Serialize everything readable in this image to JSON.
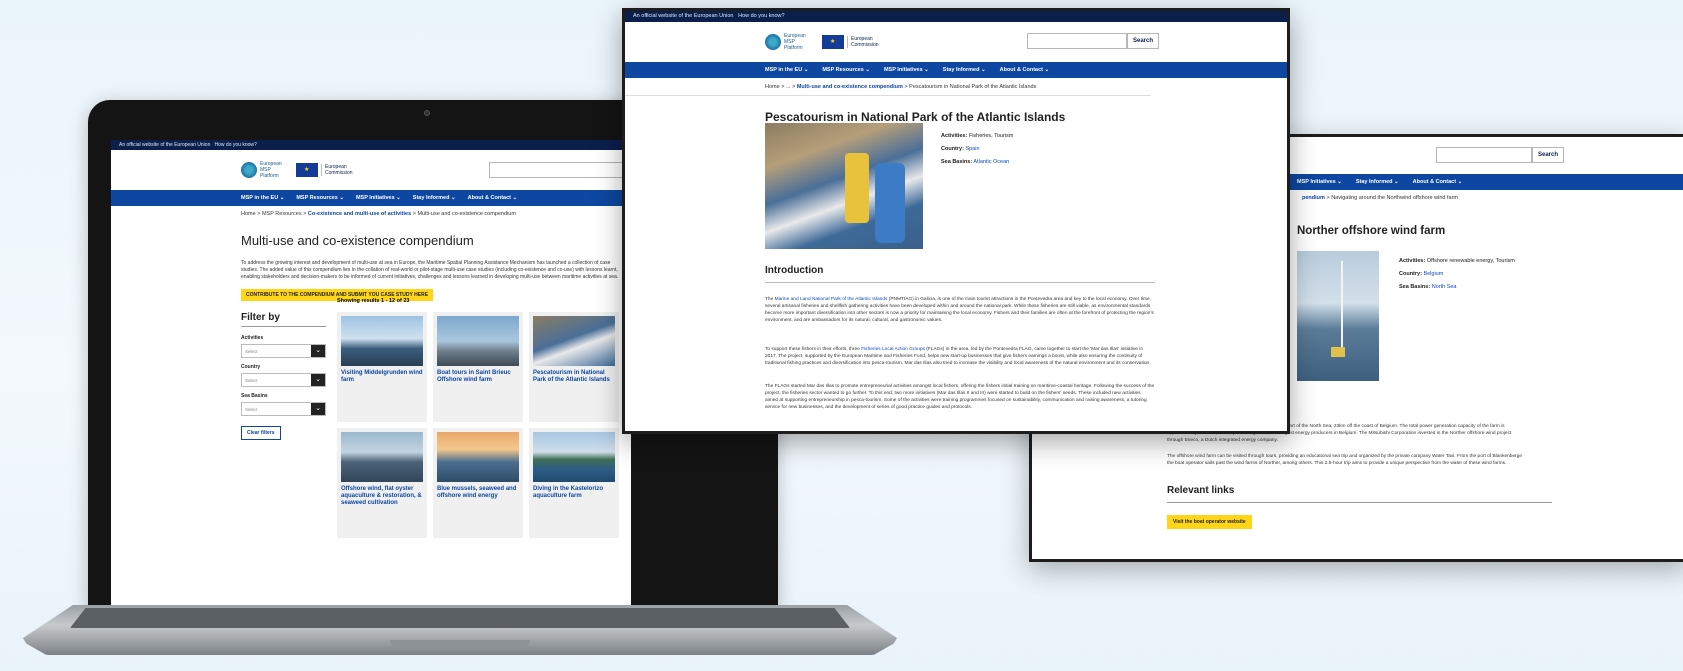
{
  "eu_strip": {
    "text": "An official website of the European Union",
    "link": "How do you know?"
  },
  "brand": {
    "logo_text": "European MSP Platform",
    "ec_text": "European Commission"
  },
  "search": {
    "button": "Search"
  },
  "nav": {
    "items": [
      "MSP in the EU ⌄",
      "MSP Resources ⌄",
      "MSP Initiatives ⌄",
      "Stay Informed ⌄",
      "About & Contact ⌄"
    ]
  },
  "laptop": {
    "breadcrumb": {
      "home": "Home",
      "sep": ">",
      "msp": "MSP Resources",
      "coex": "Co-existence and multi-use of activities",
      "current": "Multi-use and co-existence compendium"
    },
    "title": "Multi-use and co-existence compendium",
    "intro": "To address the growing interest and development of multi-use at sea in Europe, the Maritime Spatial Planning Assistance Mechanism has launched a collection of case studies. The added value of this compendium lies in the collation of real-world or pilot-stage multi-use case studies (including co-existence and co-use) with lessons learnt, enabling stakeholders and decision-makers to be informed of current initiatives, challenges and lessons learned in developing multi-use between maritime activities at sea.",
    "contribute_button": "CONTRIBUTE TO THE COMPENDIUM AND SUBMIT YOU CASE STUDY HERE",
    "results": "Showing results 1 - 12 of 23",
    "filter": {
      "title": "Filter by",
      "activities": "Activities",
      "country": "Country",
      "sea_basins": "Sea Basins",
      "select_placeholder": "Select",
      "clear": "Clear filters"
    },
    "cards": [
      "Visiting Middelgrunden wind farm",
      "Boat tours in Saint Brieuc Offshore wind farm",
      "Pescatourism in National Park of the Atlantic Islands",
      "Offshore wind, flat oyster aquaculture & restoration, & seaweed cultivation",
      "Blue mussels, seaweed and offshore wind energy",
      "Diving in the Kastelorizo aquaculture farm"
    ]
  },
  "center": {
    "breadcrumb": {
      "home": "Home",
      "sep": ">",
      "ellipsis": "...",
      "compendium": "Multi-use and co-existence compendium",
      "current": "Pescatourism in National Park of the Atlantic Islands"
    },
    "title": "Pescatourism in National Park of the Atlantic Islands",
    "meta": {
      "activities_label": "Activities:",
      "activities": "Fisheries, Tourism",
      "country_label": "Country:",
      "country": "Spain",
      "sea_label": "Sea Basins:",
      "sea": "Atlantic Ocean"
    },
    "intro_heading": "Introduction",
    "p1_link": "Marine and Land National Park of the Atlantic Islands",
    "p1": "(PNMTIAG) in Galicia, is one of the main tourist attractions in the Pontevedra area and key to the local economy. Over time, several artisanal fisheries and shellfish gathering activities have been developed within and around the national park. While these fisheries are still viable, as environmental standards become more important diversification into other sectors is now a priority for maintaining the local economy. Fishers and their families are often at the forefront of protecting the region's environment, and are ambassadors for its natural, cultural, and gastronomic values.",
    "p2_pre": "To support these fishers in their efforts, three",
    "p2_link": "Fisheries Local Action Groups",
    "p2": "(FLAGs) in the area, led by the Pontevedra FLAG, came together to start the 'Mar das Illas' initiative in 2017. The project, supported by the European Maritime and Fisheries Fund, helps new start-up businesses that give fishers earnings a boost, while also ensuring the continuity of traditional fishing practices and diversification into pesca-tourism. Mar das Illas also tried to increase the visibility and local awareness of the natural environment and its conservation.",
    "p3": "The FLAGs started Mar das Illas to promote entrepreneurial activities amongst local fishers, offering the fishers initial training on maritime-coastal heritage. Following the success of the project, the fisheries sector wanted to go further. To this end, two more initiatives (Mar das Illas II and III) were started to build on the fishers' needs. These included new activities aimed at supporting entrepreneurship in pesca-tourism. Some of the activities were training programmes focused on sustainability, communication and raising awareness, a tutoring service for new businesses, and the development of series of good practice guides and protocols."
  },
  "right": {
    "breadcrumb": {
      "pre": "pendium",
      "sep": ">",
      "current": "Navigating around the Northwind offshore wind farm"
    },
    "title": "Norther offshore wind farm",
    "meta": {
      "activities_label": "Activities:",
      "activities": "Offshore renewable energy, Tourism",
      "country_label": "Country:",
      "country": "Belgium",
      "sea_label": "Sea Basins:",
      "sea": "North Sea"
    },
    "p1": "The Norther offshore wind farm is located in the Belgian part of the North Sea, 23km off the coast of Belgium. The total power generation capacity of the farm is approximately 370 MW, thus representing one of the largest energy producers in Belgium. The Mitsubishi Corporation invested in the Norther offshore wind project through Eneco, a Dutch integrated energy company.",
    "p2": "The offshore wind farm can be visited through tours, providing an educational sea trip and organized by the private company Water Taxi. From the port of Blankenberge the boat operator sails past the wind farms of Norther, among others. This 2.5-hour trip aims to provide a unique perspective from the water of these wind farms.",
    "links_heading": "Relevant links",
    "visit_button": "Visit the boat operator website"
  },
  "colors": {
    "nav_blue": "#0d47a1",
    "eu_dark": "#0b1f4d",
    "accent_yellow": "#ffd617"
  }
}
